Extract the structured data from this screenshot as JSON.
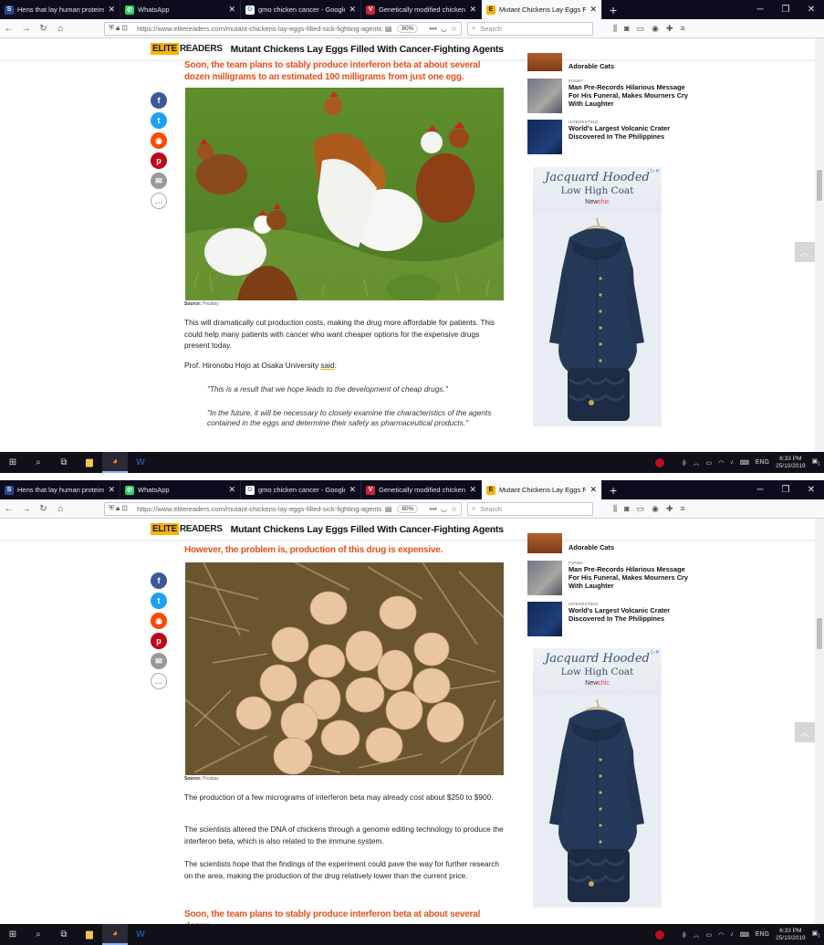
{
  "browser": {
    "tabs": [
      {
        "title": "Hens that lay human proteins i",
        "icon": "site-icon",
        "color": "#2b4a8b",
        "glyph": "S",
        "active": false
      },
      {
        "title": "WhatsApp",
        "icon": "whatsapp-icon",
        "color": "#25d366",
        "glyph": "✆",
        "active": false
      },
      {
        "title": "gmo chicken cancer - Google S",
        "icon": "google-icon",
        "color": "#ffffff",
        "glyph": "G",
        "active": false
      },
      {
        "title": "Genetically modified chickens",
        "icon": "vivaldi-icon",
        "color": "#d21f3c",
        "glyph": "V",
        "active": false
      },
      {
        "title": "Mutant Chickens Lay Eggs Fille",
        "icon": "elitereaders-icon",
        "color": "#f6b500",
        "glyph": "E",
        "active": true
      }
    ],
    "url": "https://www.elitereaders.com/mutant-chickens-lay-eggs-filled-sick-fighting-agents/",
    "zoom": "80%",
    "search_placeholder": "Search"
  },
  "site": {
    "logo_elite": "ELITE",
    "logo_readers": "READERS",
    "header_title": "Mutant Chickens Lay Eggs Filled With Cancer-Fighting Agents"
  },
  "sidebar": {
    "partial_title": "Adorable Cats",
    "items": [
      {
        "category": "FUNNY",
        "title": "Man Pre-Records Hilarious Message For His Funeral, Makes Mourners Cry With Laughter"
      },
      {
        "category": "INTERESTING",
        "title": "World's Largest Volcanic Crater Discovered In The Philippines"
      }
    ],
    "ad": {
      "line1": "Jacquard Hooded",
      "line2": "Low High Coat",
      "brand_a": "New",
      "brand_b": "chic"
    }
  },
  "top": {
    "headline": "Soon, the team plans to stably produce interferon beta at about several dozen milligrams to an estimated 100 milligrams from just one egg.",
    "caption_label": "Source:",
    "caption_value": "Pixabay",
    "para1": "This will dramatically cut production costs, making the drug more affordable for patients. This could help many patients with cancer who want cheaper options for the expensive drugs present today.",
    "para2_lead": "Prof. Hironobu Hojo at Osaka University ",
    "para2_link": "said",
    "para2_tail": ":",
    "quote1": "\"This is a result that we hope leads to the development of cheap drugs.\"",
    "quote2": "\"In the future, it will be necessary to closely examine the characteristics of the agents contained in the eggs and determine their safety as pharmaceutical products.\""
  },
  "bottom": {
    "headline": "However, the problem is, production of this drug is expensive.",
    "caption_label": "Source:",
    "caption_value": "Pixabay",
    "para1": "The production of a few micrograms of interferon beta may already cost about $250 to $900.",
    "para2": "The scientists altered the DNA of chickens through a genome editing technology to produce the interferon beta, which is also related to the immune system.",
    "para3": "The scientists hope that the findings of the experiment could pave the way for further research on the area, making the production of the drug relatively lower than the current price.",
    "headline2": "Soon, the team plans to stably produce interferon beta at about several dozen"
  },
  "taskbar": {
    "lang": "ENG",
    "time": "6:33 PM",
    "date": "25/10/2019",
    "notif_count": "1"
  }
}
